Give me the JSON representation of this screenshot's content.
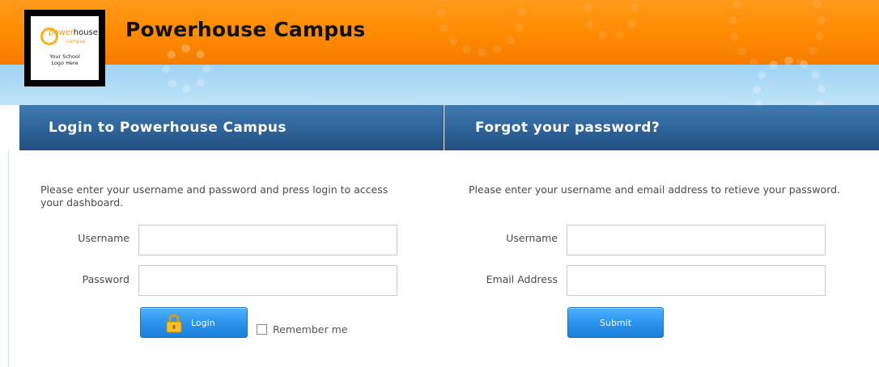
{
  "site": {
    "title": "Powerhouse Campus",
    "logo": {
      "word_main": "power",
      "word_house": "house",
      "word_sub": "campus",
      "caption": "Your School\nLogo Here"
    }
  },
  "login": {
    "heading": "Login to Powerhouse Campus",
    "intro": "Please enter your username and password and press login to access your dashboard.",
    "username_label": "Username",
    "username_value": "",
    "password_label": "Password",
    "password_value": "",
    "login_button": "Login",
    "remember_label": "Remember me",
    "remember_checked": false
  },
  "forgot": {
    "heading": "Forgot your password?",
    "intro": "Please enter your username and email address to retieve your password.",
    "username_label": "Username",
    "username_value": "",
    "email_label": "Email Address",
    "email_value": "",
    "submit_button": "Submit"
  },
  "colors": {
    "banner": "#ff8a00",
    "header_blue": "#2e6399",
    "button_blue": "#2b93ee",
    "sky": "#bfe3f8"
  },
  "icons": {
    "login_button_icon": "lock-icon",
    "remember_checkbox": "checkbox-icon"
  }
}
